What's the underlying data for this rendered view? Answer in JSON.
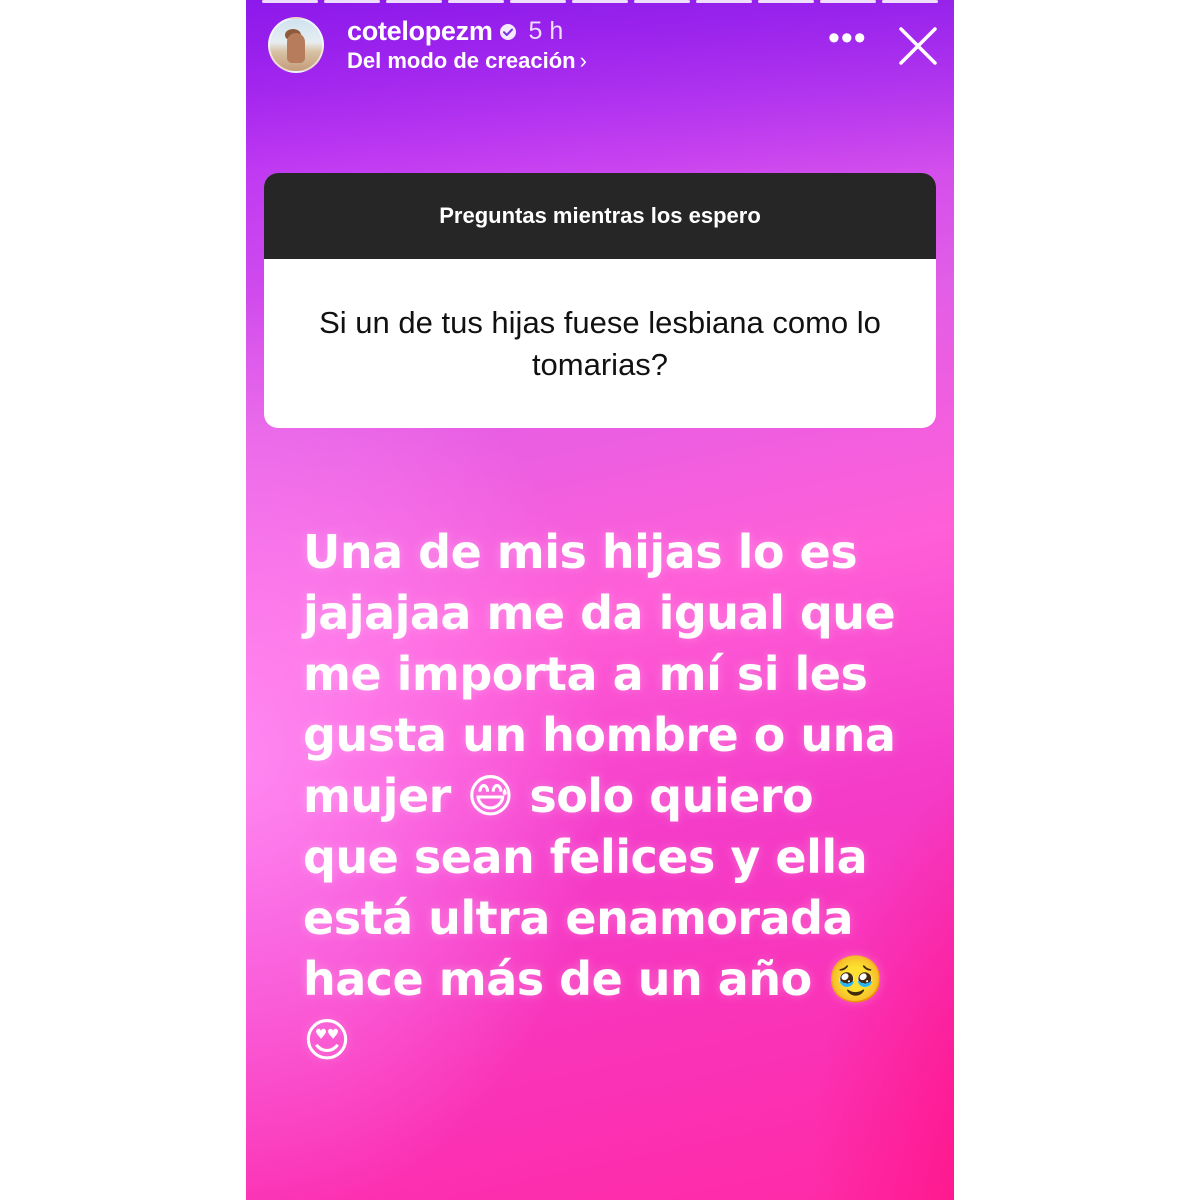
{
  "story": {
    "progress_segments": 11,
    "username": "cotelopezm",
    "verified": true,
    "time_ago": "5 h",
    "source_label": "Del modo de creación",
    "source_chevron": "›",
    "more_icon": "more-horizontal-icon",
    "more_glyph": "•••",
    "close_icon": "close-icon"
  },
  "question_sticker": {
    "header": "Preguntas mientras los espero",
    "question": "Si un de tus hijas fuese lesbiana como lo tomarias?"
  },
  "answer": {
    "text": "Una de mis hijas lo es jajajaa me da igual que me importa a mí si les gusta un hombre o una mujer 😅 solo quiero que sean felices y ella está ultra enamorada hace más de un año 🥹 😍"
  },
  "colors": {
    "header_bar": "#262626",
    "gradient_top": "#a51ff0",
    "gradient_mid": "#ff5fd8",
    "gradient_bottom": "#ff2aa6"
  }
}
